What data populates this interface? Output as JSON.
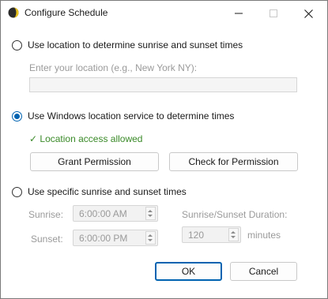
{
  "window": {
    "title": "Configure Schedule",
    "icon": "sun-moon-app-icon"
  },
  "option_location": {
    "label": "Use location to determine sunrise and sunset times",
    "selected": false,
    "input_label": "Enter your location (e.g., New York NY):",
    "input_value": ""
  },
  "option_windows": {
    "label": "Use Windows location service to determine times",
    "selected": true,
    "status": "✓ Location access allowed",
    "grant_button": "Grant Permission",
    "check_button": "Check for Permission"
  },
  "option_specific": {
    "label": "Use specific sunrise and sunset times",
    "selected": false,
    "sunrise_label": "Sunrise:",
    "sunrise_value": "6:00:00 AM",
    "sunset_label": "Sunset:",
    "sunset_value": "6:00:00 PM",
    "duration_label": "Sunrise/Sunset Duration:",
    "duration_value": "120",
    "duration_unit": "minutes"
  },
  "footer": {
    "ok_button": "OK",
    "cancel_button": "Cancel"
  },
  "colors": {
    "accent": "#0063b1",
    "success": "#3a8a28",
    "disabled_text": "#9a9a9a"
  }
}
